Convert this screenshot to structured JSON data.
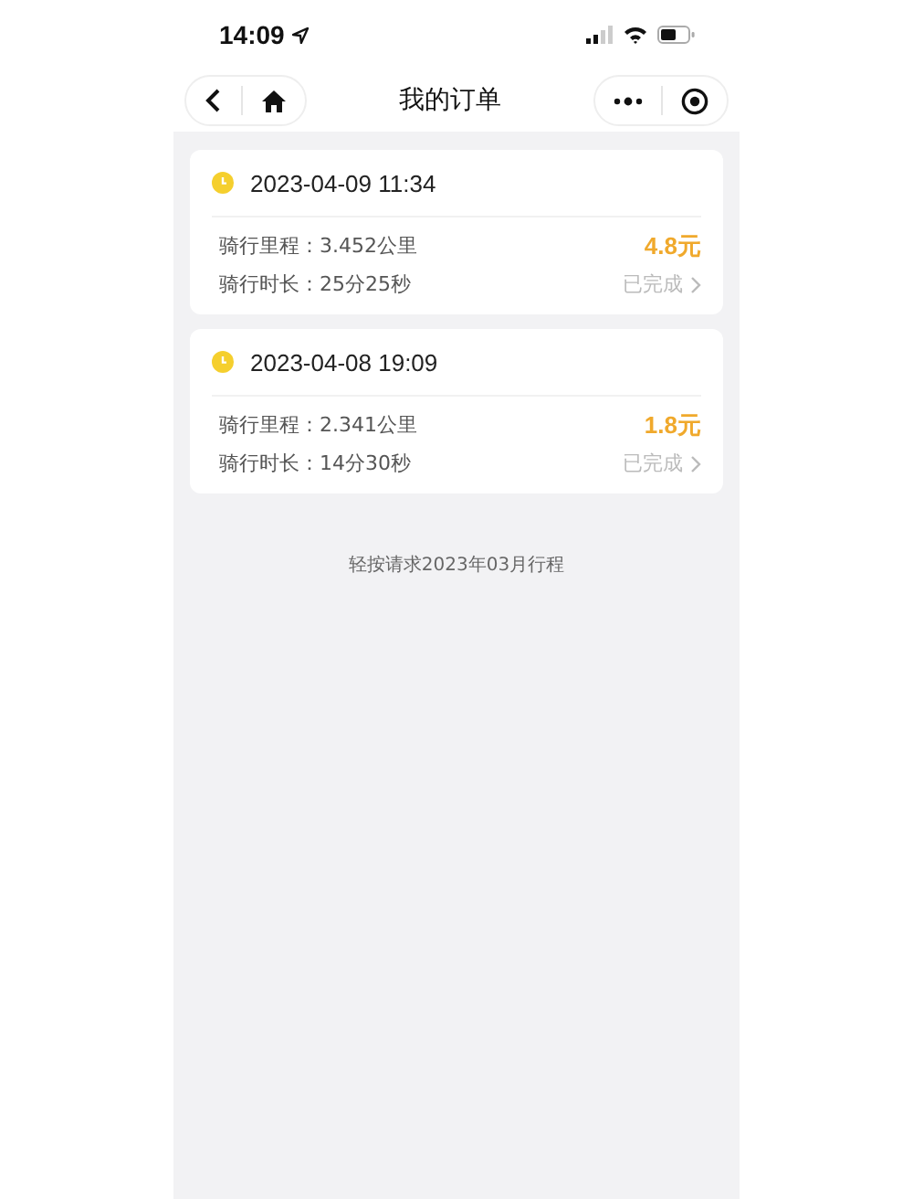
{
  "status_bar": {
    "time": "14:09"
  },
  "nav": {
    "title": "我的订单"
  },
  "orders": [
    {
      "datetime": "2023-04-09 11:34",
      "distance_label": "骑行里程：",
      "distance": "3.452公里",
      "duration_label": "骑行时长：",
      "duration": "25分25秒",
      "price": "4.8元",
      "status": "已完成"
    },
    {
      "datetime": "2023-04-08 19:09",
      "distance_label": "骑行里程：",
      "distance": "2.341公里",
      "duration_label": "骑行时长：",
      "duration": "14分30秒",
      "price": "1.8元",
      "status": "已完成"
    }
  ],
  "footer_link": "轻按请求2023年03月行程"
}
